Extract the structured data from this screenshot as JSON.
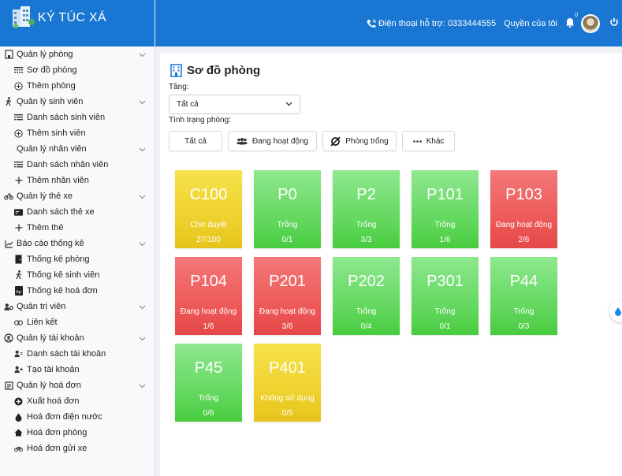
{
  "app": {
    "title": "KÝ TÚC XÁ"
  },
  "topbar": {
    "support_label": "Điện thoại hỗ trợ: 0333444555",
    "roles_label": "Quyền của tôi",
    "notification_count": "0"
  },
  "sidebar": {
    "groups": [
      {
        "label": "Quản lý phòng",
        "icon": "building-icon",
        "items": [
          {
            "label": "Sơ đồ phòng",
            "icon": "grid-icon"
          },
          {
            "label": "Thêm phòng",
            "icon": "plus-circle-icon"
          }
        ]
      },
      {
        "label": "Quản lý sinh viên",
        "icon": "person-walking-icon",
        "items": [
          {
            "label": "Danh sách sinh viên",
            "icon": "list-icon"
          },
          {
            "label": "Thêm sinh viên",
            "icon": "plus-circle-icon"
          }
        ]
      },
      {
        "label": "Quản lý nhân viên",
        "icon": "",
        "items": [
          {
            "label": "Danh sách nhân viên",
            "icon": "list-icon"
          },
          {
            "label": "Thêm nhân viên",
            "icon": "plus-icon"
          }
        ]
      },
      {
        "label": "Quản lý thẻ xe",
        "icon": "motorbike-icon",
        "items": [
          {
            "label": "Danh sách thẻ xe",
            "icon": "card-icon"
          },
          {
            "label": "Thêm thẻ",
            "icon": "plus-icon"
          }
        ]
      },
      {
        "label": "Báo cáo thống kê",
        "icon": "chart-line-icon",
        "items": [
          {
            "label": "Thống kê phòng",
            "icon": "door-icon"
          },
          {
            "label": "Thống kê sinh viên",
            "icon": "person-walking-icon"
          },
          {
            "label": "Thống kê hoá đơn",
            "icon": "invoice-icon"
          }
        ]
      },
      {
        "label": "Quản trị viên",
        "icon": "user-gear-icon",
        "items": [
          {
            "label": "Liên kết",
            "icon": "link-icon"
          }
        ]
      },
      {
        "label": "Quản lý tài khoản",
        "icon": "user-circle-icon",
        "items": [
          {
            "label": "Danh sách tài khoản",
            "icon": "users-icon"
          },
          {
            "label": "Tạo tài khoản",
            "icon": "user-plus-icon"
          }
        ]
      },
      {
        "label": "Quản lý hoá đơn",
        "icon": "receipt-icon",
        "items": [
          {
            "label": "Xuất hoá đơn",
            "icon": "plus-circle-filled-icon"
          },
          {
            "label": "Hoá đơn điện nước",
            "icon": "drop-icon"
          },
          {
            "label": "Hoá đơn phòng",
            "icon": "home-icon"
          },
          {
            "label": "Hoá đơn gửi xe",
            "icon": "bicycle-icon"
          }
        ]
      }
    ]
  },
  "main": {
    "title": "Sơ đồ phòng",
    "floor_label": "Tầng:",
    "floor_value": "Tất cả",
    "status_label": "Tình trạng phòng:",
    "filters": [
      {
        "label": "Tất cả",
        "icon": ""
      },
      {
        "label": "Đang hoạt động",
        "icon": "users-icon"
      },
      {
        "label": "Phòng trống",
        "icon": "empty-set-icon"
      },
      {
        "label": "Khác",
        "icon": "dots-icon"
      }
    ],
    "rooms": [
      {
        "code": "C100",
        "status": "Chờ duyệt",
        "occupancy": "27/100",
        "color": "yellow"
      },
      {
        "code": "P0",
        "status": "Trống",
        "occupancy": "0/1",
        "color": "green"
      },
      {
        "code": "P2",
        "status": "Trống",
        "occupancy": "3/3",
        "color": "green"
      },
      {
        "code": "P101",
        "status": "Trống",
        "occupancy": "1/6",
        "color": "green"
      },
      {
        "code": "P103",
        "status": "Đang hoạt động",
        "occupancy": "2/6",
        "color": "red"
      },
      {
        "code": "P104",
        "status": "Đang hoạt động",
        "occupancy": "1/6",
        "color": "red"
      },
      {
        "code": "P201",
        "status": "Đang hoạt động",
        "occupancy": "3/6",
        "color": "red"
      },
      {
        "code": "P202",
        "status": "Trống",
        "occupancy": "0/4",
        "color": "green"
      },
      {
        "code": "P301",
        "status": "Trống",
        "occupancy": "0/1",
        "color": "green"
      },
      {
        "code": "P44",
        "status": "Trống",
        "occupancy": "0/3",
        "color": "green"
      },
      {
        "code": "P45",
        "status": "Trống",
        "occupancy": "0/6",
        "color": "green"
      },
      {
        "code": "P401",
        "status": "Không sử dụng",
        "occupancy": "0/5",
        "color": "yellow"
      }
    ]
  },
  "colors": {
    "header": "#1976d2",
    "green": "#5fd65a",
    "yellow": "#edcf2a",
    "red": "#ec5656"
  }
}
